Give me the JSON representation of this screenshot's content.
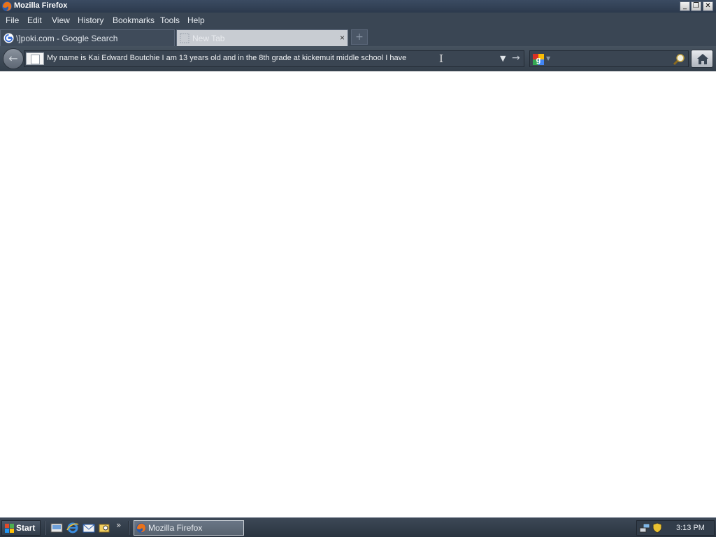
{
  "window": {
    "title": "Mozilla Firefox"
  },
  "window_controls": {
    "minimize": "_",
    "restore": "❐",
    "close": "✕"
  },
  "menu": {
    "items": [
      {
        "label": "File",
        "mnemonic": "F"
      },
      {
        "label": "Edit",
        "mnemonic": "E"
      },
      {
        "label": "View",
        "mnemonic": "V"
      },
      {
        "label": "History",
        "mnemonic": "H"
      },
      {
        "label": "Bookmarks",
        "mnemonic": "B"
      },
      {
        "label": "Tools",
        "mnemonic": "T"
      },
      {
        "label": "Help",
        "mnemonic": "H"
      }
    ]
  },
  "tabs": [
    {
      "label": "\\]poki.com - Google Search",
      "icon": "google-icon",
      "active": false
    },
    {
      "label": "New Tab",
      "icon": "blank-page-icon",
      "active": true,
      "close": "×"
    }
  ],
  "newtab_button": "+",
  "navbar": {
    "back": "←",
    "url_value": "My name is Kai Edward Boutchie I am 13 years old and in the 8th grade at kickemuit middle school I have",
    "dropdown": "▼",
    "go": "→",
    "search_value": ""
  },
  "taskbar": {
    "start_label": "Start",
    "quick_launch_more": "»",
    "items": [
      {
        "label": "Mozilla Firefox",
        "icon": "firefox-icon"
      }
    ],
    "clock": "3:13 PM"
  },
  "colors": {
    "chrome_bg": "#3a4654",
    "title_bg": "#2c3a4d",
    "content_bg": "#ffffff"
  }
}
